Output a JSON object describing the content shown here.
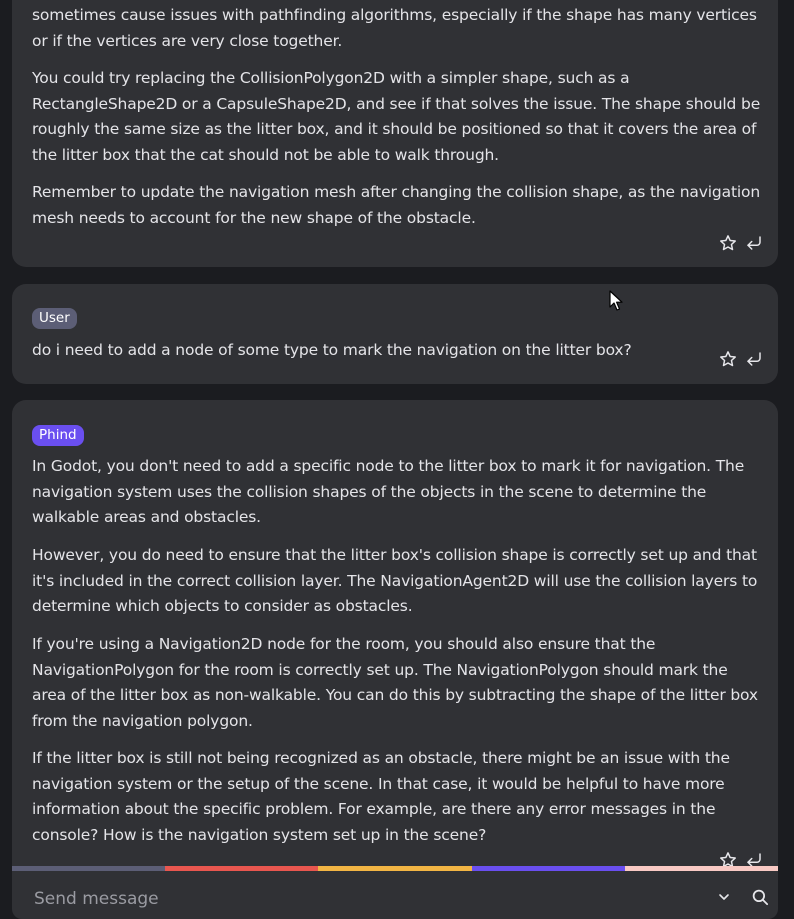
{
  "messages": [
    {
      "role_label": "",
      "paragraphs": [
        "sometimes cause issues with pathfinding algorithms, especially if the shape has many vertices or if the vertices are very close together.",
        "You could try replacing the CollisionPolygon2D with a simpler shape, such as a RectangleShape2D or a CapsuleShape2D, and see if that solves the issue. The shape should be roughly the same size as the litter box, and it should be positioned so that it covers the area of the litter box that the cat should not be able to walk through.",
        "Remember to update the navigation mesh after changing the collision shape, as the navigation mesh needs to account for the new shape of the obstacle."
      ]
    },
    {
      "role_label": "User",
      "paragraphs": [
        "do i need to add a node of some type to mark the navigation on the litter box?"
      ]
    },
    {
      "role_label": "Phind",
      "paragraphs": [
        "In Godot, you don't need to add a specific node to the litter box to mark it for navigation. The navigation system uses the collision shapes of the objects in the scene to determine the walkable areas and obstacles.",
        "However, you do need to ensure that the litter box's collision shape is correctly set up and that it's included in the correct collision layer. The NavigationAgent2D will use the collision layers to determine which objects to consider as obstacles.",
        "If you're using a Navigation2D node for the room, you should also ensure that the NavigationPolygon for the room is correctly set up. The NavigationPolygon should mark the area of the litter box as non-walkable. You can do this by subtracting the shape of the litter box from the navigation polygon.",
        "If the litter box is still not being recognized as an obstacle, there might be an issue with the navigation system or the setup of the scene. In that case, it would be helpful to have more information about the specific problem. For example, are there any error messages in the console? How is the navigation system set up in the scene?"
      ]
    }
  ],
  "message_actions": {
    "favorite_icon": "star-outline-icon",
    "reply_icon": "return-arrow-icon"
  },
  "input": {
    "placeholder": "Send message",
    "value": "",
    "dropdown_icon": "chevron-down-icon",
    "search_icon": "search-icon"
  },
  "colors": {
    "background": "#1b1c20",
    "card": "#303135",
    "user_badge": "#5c5e76",
    "phind_badge": "#6a4ff0",
    "rainbow": [
      "#5c5e76",
      "#e8564f",
      "#f2b544",
      "#6a4ff0",
      "#f8c9c4"
    ]
  }
}
